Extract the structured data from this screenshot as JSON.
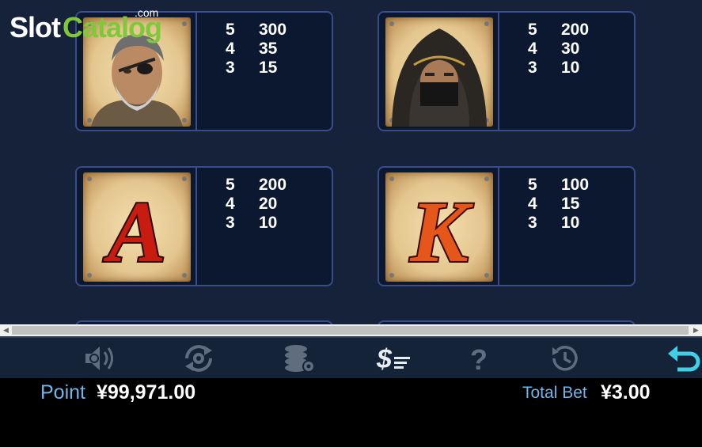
{
  "logo": {
    "slot": "Slot",
    "catalog": "Catalog",
    "com": ".com"
  },
  "paytable": [
    {
      "symbol": "eyepatch-warrior-icon",
      "pays": [
        {
          "count": "5",
          "amount": "300"
        },
        {
          "count": "4",
          "amount": "35"
        },
        {
          "count": "3",
          "amount": "15"
        }
      ]
    },
    {
      "symbol": "hooded-assassin-icon",
      "pays": [
        {
          "count": "5",
          "amount": "200"
        },
        {
          "count": "4",
          "amount": "30"
        },
        {
          "count": "3",
          "amount": "10"
        }
      ]
    },
    {
      "symbol": "letter-a-icon",
      "letter": "A",
      "pays": [
        {
          "count": "5",
          "amount": "200"
        },
        {
          "count": "4",
          "amount": "20"
        },
        {
          "count": "3",
          "amount": "10"
        }
      ]
    },
    {
      "symbol": "letter-k-icon",
      "letter": "K",
      "pays": [
        {
          "count": "5",
          "amount": "100"
        },
        {
          "count": "4",
          "amount": "15"
        },
        {
          "count": "3",
          "amount": "10"
        }
      ]
    }
  ],
  "toolbar": {
    "icons": [
      "sound-settings-icon",
      "autoplay-settings-icon",
      "bet-settings-icon",
      "paytable-icon",
      "help-icon",
      "history-icon",
      "back-icon"
    ],
    "active": "paytable-icon"
  },
  "footer": {
    "point_label": "Point",
    "point_value": "¥99,971.00",
    "bet_label": "Total Bet",
    "bet_value": "¥3.00"
  },
  "colors": {
    "accent": "#6fb6ea",
    "back_icon": "#3fd0e8",
    "card_border": "#3a4b8c"
  }
}
